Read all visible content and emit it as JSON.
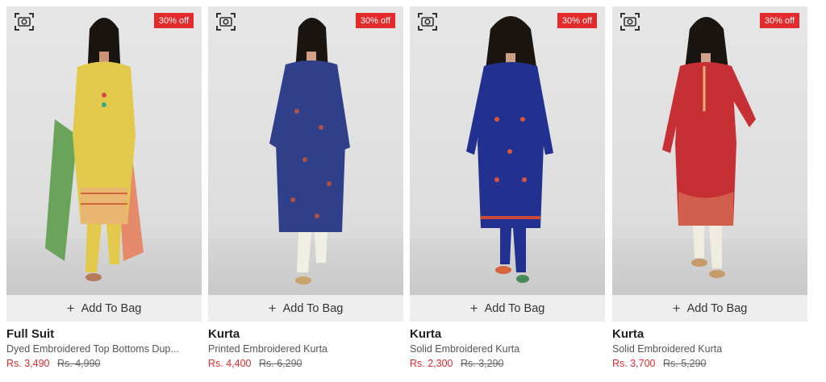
{
  "products": [
    {
      "discount": "30% off",
      "add_label": "Add To Bag",
      "title": "Full Suit",
      "description": "Dyed Embroidered Top Bottoms Dup...",
      "price": "Rs. 3,490",
      "old_price": "Rs. 4,990",
      "outfit_color": "#e2c94c"
    },
    {
      "discount": "30% off",
      "add_label": "Add To Bag",
      "title": "Kurta",
      "description": "Printed Embroidered Kurta",
      "price": "Rs. 4,400",
      "old_price": "Rs. 6,290",
      "outfit_color": "#2f3f8a"
    },
    {
      "discount": "30% off",
      "add_label": "Add To Bag",
      "title": "Kurta",
      "description": "Solid Embroidered Kurta",
      "price": "Rs. 2,300",
      "old_price": "Rs. 3,290",
      "outfit_color": "#22318f"
    },
    {
      "discount": "30% off",
      "add_label": "Add To Bag",
      "title": "Kurta",
      "description": "Solid Embroidered Kurta",
      "price": "Rs. 3,700",
      "old_price": "Rs. 5,290",
      "outfit_color": "#c62f34"
    }
  ],
  "colors": {
    "accent": "#e32b2b",
    "button_bg": "#eeeeee"
  },
  "icons": {
    "scan": "image-search-icon",
    "add": "plus-icon"
  }
}
